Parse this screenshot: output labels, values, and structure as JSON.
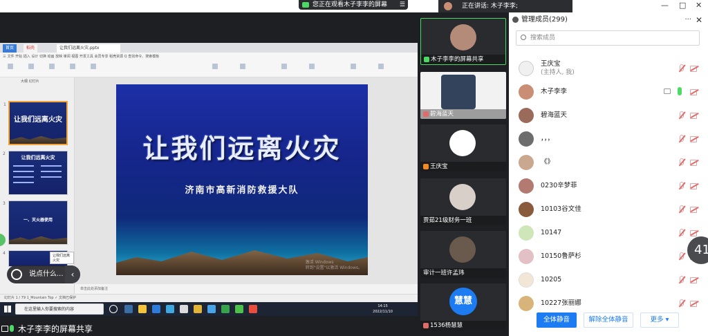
{
  "top": {
    "watching_text": "您正在观看木子李李的屏幕",
    "speaking_text": "正在讲话: 木子李李;",
    "win_min": "—",
    "win_max": "□",
    "win_close": "✕"
  },
  "wps": {
    "tabs": [
      "首页",
      "稻壳",
      "让我们远离火灾.pptx"
    ],
    "menu_items": "三 文件  开始  插入  设计  切换  动画  放映  审阅  视图  开发工具  会员专享  稻壳资源  Q 查找命令、搜索模板",
    "thumb_header": "大纲  幻灯片",
    "thumb1_title": "让我们远离火灾",
    "thumb2_title": "让我们远离火灾",
    "thumb3_title": "一、灭火器使用",
    "tooltip": "让我们远离火灾",
    "notes": "单击此处添加备注",
    "status": "幻灯片 1 / 79    1_Mountain Top    ✓ 文档已保护"
  },
  "slide": {
    "title": "让我们远离火灾",
    "subtitle": "济南市高新消防救援大队",
    "watermark_1": "激活 Windows",
    "watermark_2": "转到\"设置\"以激活 Windows。"
  },
  "taskbar": {
    "search_placeholder": "在这里输入你要搜索的内容",
    "time": "14:15",
    "date": "2022/11/10"
  },
  "chat": {
    "placeholder": "说点什么..."
  },
  "share_label": "木子李李的屏幕共享",
  "videos": [
    {
      "label": "木子李李的屏幕共享",
      "avatar_color": "#b48a78"
    },
    {
      "label": "碧海蓝天",
      "avatar_color": "#33435c"
    },
    {
      "label": "王庆宝",
      "avatar_color": "#ffffff"
    },
    {
      "label": "贾茹21级财务一班",
      "avatar_color": "#d8cfc8"
    },
    {
      "label": "审计一班许孟玮",
      "avatar_color": "#6a5a4e"
    },
    {
      "label": "1536杨慧慧",
      "avatar_text": "慧慧",
      "avatar_color": "#1d7cf2"
    }
  ],
  "panel": {
    "title": "管理成员(299)",
    "more": "···",
    "close": "✕",
    "search_placeholder": "搜索成员",
    "members": [
      {
        "name": "王庆宝",
        "sub": "(主持人, 我)",
        "color": "#ffffff"
      },
      {
        "name": "木子李李",
        "sub": "",
        "color": "#c98e73"
      },
      {
        "name": "碧海蓝天",
        "sub": "",
        "color": "#9a6b5a"
      },
      {
        "name": "，，，",
        "sub": "",
        "color": "#6d6d6d"
      },
      {
        "name": "《》",
        "sub": "",
        "color": "#caa88f"
      },
      {
        "name": "0230辛梦菲",
        "sub": "",
        "color": "#b27a70"
      },
      {
        "name": "10103谷文佳",
        "sub": "",
        "color": "#8a5a3c"
      },
      {
        "name": "10147",
        "sub": "",
        "color": "#cfe6b8"
      },
      {
        "name": "10150鲁萨杉",
        "sub": "",
        "color": "#e2c0c5"
      },
      {
        "name": "10205",
        "sub": "",
        "color": "#f2e6d6"
      },
      {
        "name": "10227张丽娜",
        "sub": "",
        "color": "#d9b47a"
      }
    ],
    "mute_all": "全体静音",
    "unmute_all": "解除全体静音",
    "more_btn": "更多 ▾"
  },
  "badge": "41"
}
